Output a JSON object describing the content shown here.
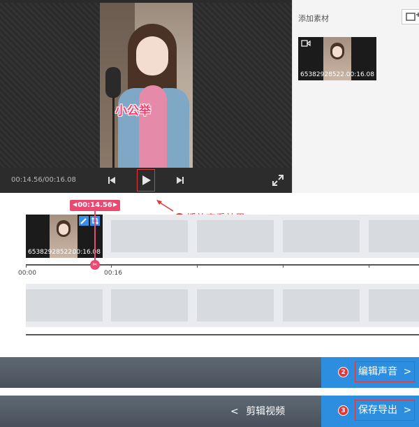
{
  "player": {
    "time_readout": "00:14.56/00:16.08",
    "video_caption": "小公举",
    "icons": [
      "skip-back-icon",
      "play-icon",
      "skip-forward-icon",
      "fullscreen-icon"
    ]
  },
  "material_panel": {
    "title": "添加素材",
    "items": [
      {
        "filename": "65382928522...",
        "duration": "00:16.08"
      }
    ]
  },
  "annotations": {
    "step1_number": "1",
    "step1_text": "播放查看效果",
    "step2_number": "2",
    "step3_number": "3"
  },
  "timeline": {
    "playhead_time": "00:14.56",
    "clip": {
      "filename": "65382928522...",
      "duration": "00:16.08"
    },
    "tick_labels": [
      "00:00",
      "00:16"
    ],
    "playhead_knob_icon": "scissors-icon"
  },
  "actions": {
    "edit_audio_label": "编辑声音",
    "back_label": "剪辑视频",
    "save_export_label": "保存导出",
    "chevron_right": ">",
    "chevron_left": "<"
  },
  "colors": {
    "accent_red": "#e0383b",
    "accent_pink": "#e84a72",
    "accent_blue": "#2d8ee0"
  }
}
